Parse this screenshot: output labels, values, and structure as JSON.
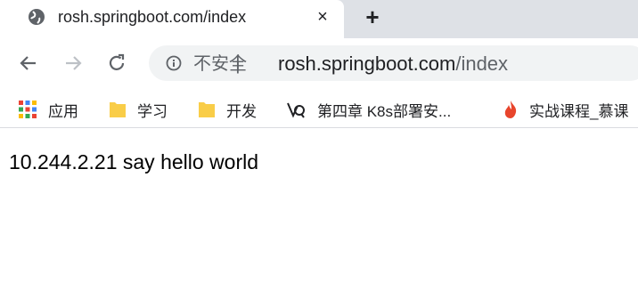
{
  "tab": {
    "title": "rosh.springboot.com/index",
    "close_label": "×",
    "favicon": "globe-icon"
  },
  "new_tab_label": "+",
  "toolbar": {
    "back_icon": "back-arrow-icon",
    "forward_icon": "forward-arrow-icon",
    "reload_icon": "reload-icon"
  },
  "omnibox": {
    "security_icon": "info-icon",
    "security_label": "不安全",
    "separator": "|",
    "url_host": "rosh.springboot.com",
    "url_path": "/index"
  },
  "bookmarks": [
    {
      "label": "应用",
      "icon": "apps-grid-icon"
    },
    {
      "label": "学习",
      "icon": "folder-icon"
    },
    {
      "label": "开发",
      "icon": "folder-icon"
    },
    {
      "label": "第四章 K8s部署安...",
      "icon": "bookmark-site-icon"
    },
    {
      "label": "实战课程_慕课",
      "icon": "flame-icon"
    }
  ],
  "page": {
    "body_text": "10.244.2.21 say hello world"
  },
  "colors": {
    "tabstrip": "#dee1e6",
    "omnibox": "#f1f3f4",
    "folder": "#f9cd48",
    "flame": "#e8452c"
  }
}
